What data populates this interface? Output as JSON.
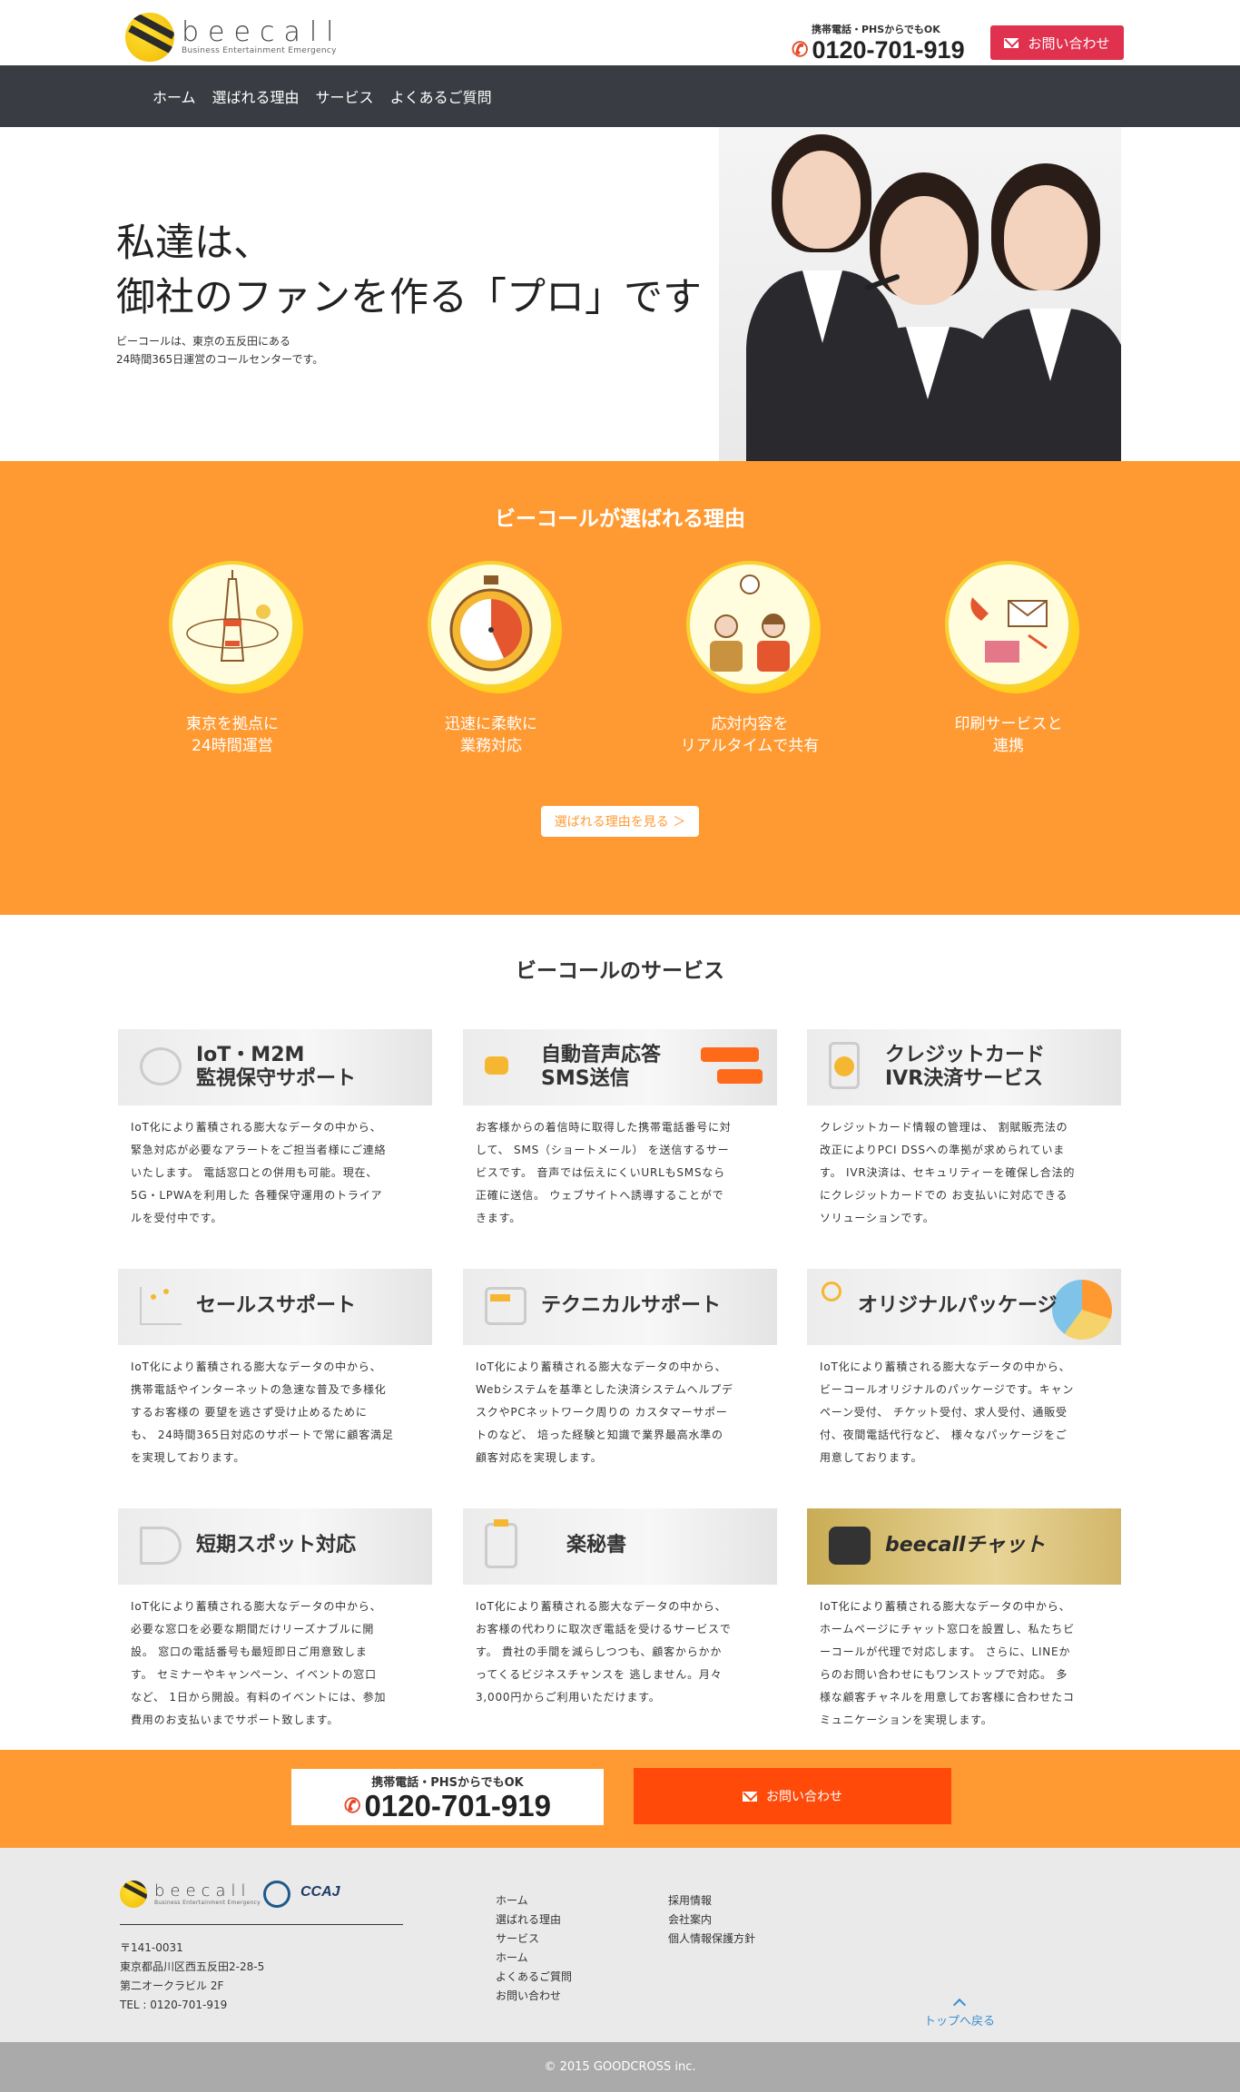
{
  "header": {
    "logo_name": "beecall",
    "logo_tagline": "Business Entertainment Emergency",
    "phone_caption": "携帯電話・PHSからでもOK",
    "phone_number": "0120-701-919",
    "contact_label": "お問い合わせ"
  },
  "nav": {
    "items": [
      "ホーム",
      "選ばれる理由",
      "サービス",
      "よくあるご質問"
    ]
  },
  "hero": {
    "title_line1": "私達は、",
    "title_line2": "御社のファンを作る「プロ」です",
    "sub_line1": "ビーコールは、東京の五反田にある",
    "sub_line2": "24時間365日運営のコールセンターです。"
  },
  "reasons": {
    "title": "ビーコールが選ばれる理由",
    "items": [
      {
        "line1": "東京を拠点に",
        "line2": "24時間運営",
        "icon": "tokyo-tower-icon"
      },
      {
        "line1": "迅速に柔軟に",
        "line2": "業務対応",
        "icon": "stopwatch-icon"
      },
      {
        "line1": "応対内容を",
        "line2": "リアルタイムで共有",
        "icon": "operators-icon"
      },
      {
        "line1": "印刷サービスと",
        "line2": "連携",
        "icon": "print-mail-icon"
      }
    ],
    "button_label": "選ばれる理由を見る ＞"
  },
  "services": {
    "title": "ビーコールのサービス",
    "items": [
      {
        "title1": "IoT・M2M",
        "title2": "監視保守サポート",
        "icon": "cloud-icon",
        "desc": [
          "IoT化により蓄積される膨大なデータの中から、",
          "緊急対応が必要なアラートをご担当者様にご連絡",
          "いたします。 電話窓口との併用も可能。現在、",
          "5G・LPWAを利用した 各種保守運用のトライア",
          "ルを受付中です。"
        ]
      },
      {
        "title1": "自動音声応答",
        "title2": "SMS送信",
        "icon": "chat-bubble-icon",
        "desc": [
          "お客様からの着信時に取得した携帯電話番号に対",
          "して、 SMS（ショートメール） を送信するサー",
          "ビスです。 音声では伝えにくいURLもSMSなら",
          "正確に送信。 ウェブサイトへ誘導することがで",
          "きます。"
        ]
      },
      {
        "title1": "クレジットカード",
        "title2": "IVR決済サービス",
        "icon": "coin-phone-icon",
        "desc": [
          "クレジットカード情報の管理は、 割賦販売法の",
          "改正によりPCI DSSへの準拠が求められていま",
          "す。 IVR決済は、セキュリティーを確保し合法的",
          "にクレジットカードでの お支払いに対応できる",
          "ソリューションです。"
        ]
      },
      {
        "title1": "セールスサポート",
        "title2": "",
        "icon": "chart-icon",
        "desc": [
          "IoT化により蓄積される膨大なデータの中から、",
          "携帯電話やインターネットの急速な普及で多様化",
          "するお客様の 要望を逃さず受け止めるために",
          "も、 24時間365日対応のサポートで常に顧客満足",
          "を実現しております。"
        ]
      },
      {
        "title1": "テクニカルサポート",
        "title2": "",
        "icon": "monitor-icon",
        "desc": [
          "IoT化により蓄積される膨大なデータの中から、",
          "Webシステムを基準とした決済システムヘルプデ",
          "スクやPCネットワーク周りの カスタマーサポー",
          "トのなど、 培った経験と知識で業界最高水準の",
          "顧客対応を実現します。"
        ]
      },
      {
        "title1": "オリジナルパッケージ",
        "title2": "",
        "icon": "wrench-gear-icon",
        "desc": [
          "IoT化により蓄積される膨大なデータの中から、",
          "ビーコールオリジナルのパッケージです。キャン",
          "ペーン受付、 チケット受付、求人受付、通販受",
          "付、夜間電話代行など、 様々なパッケージをご",
          "用意しております。"
        ]
      },
      {
        "title1": "短期スポット対応",
        "title2": "",
        "icon": "megaphone-icon",
        "desc": [
          "IoT化により蓄積される膨大なデータの中から、",
          "必要な窓口を必要な期間だけリーズナブルに開",
          "設。 窓口の電話番号も最短即日ご用意致しま",
          "す。 セミナーやキャンペーン、イベントの窓口",
          "など、 1日から開設。有料のイベントには、参加",
          "費用のお支払いまでサポート致します。"
        ]
      },
      {
        "title1": "楽秘書",
        "title2": "",
        "icon": "clipboard-icon",
        "desc": [
          "IoT化により蓄積される膨大なデータの中から、",
          "お客様の代わりに取次ぎ電話を受けるサービスで",
          "す。 貴社の手間を減らしつつも、顧客からかか",
          "ってくるビジネスチャンスを 逃しません。月々",
          "3,000円からご利用いただけます。"
        ]
      },
      {
        "title1": "beecallチャット",
        "title2": "",
        "icon": "chat-icon",
        "desc": [
          "IoT化により蓄積される膨大なデータの中から、",
          "ホームページにチャット窓口を設置し、私たちビ",
          "ーコールが代理で対応します。 さらに、LINEか",
          "らのお問い合わせにもワンストップで対応。 多",
          "様な顧客チャネルを用意してお客様に合わせたコ",
          "ミュニケーションを実現します。"
        ]
      }
    ]
  },
  "cta": {
    "phone_caption": "携帯電話・PHSからでもOK",
    "phone_number": "0120-701-919",
    "contact_label": "お問い合わせ"
  },
  "footer": {
    "logo_name": "beecall",
    "logo_tagline": "Business Entertainment Emergency",
    "badge_text": "CCAJ",
    "address": [
      "〒141-0031",
      "東京都品川区西五反田2-28-5",
      "第二オークラビル 2F",
      "TEL : 0120-701-919"
    ],
    "col1": [
      "ホーム",
      "選ばれる理由",
      "サービス",
      "ホーム",
      "よくあるご質問",
      "お問い合わせ"
    ],
    "col2": [
      "採用情報",
      "会社案内",
      "個人情報保護方針"
    ],
    "to_top": "トップへ戻る",
    "copyright": "© 2015 GOODCROSS inc."
  },
  "colors": {
    "accent_orange": "#ff9a33",
    "contact_red": "#e0314e",
    "cta_red": "#ff4a0a",
    "nav_dark": "#393c42"
  }
}
